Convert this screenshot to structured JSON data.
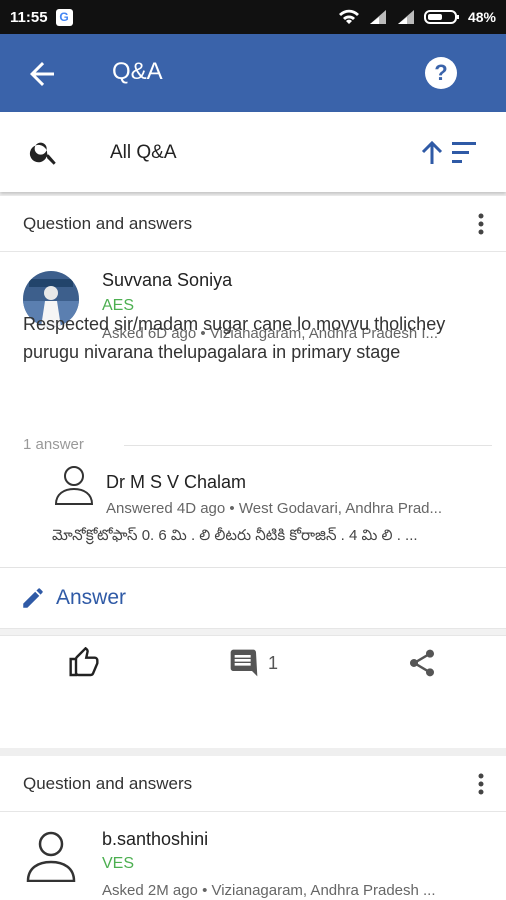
{
  "status_bar": {
    "time": "11:55",
    "app_badge": "G",
    "battery": "48%"
  },
  "app_bar": {
    "title": "Q&A",
    "back_icon": "arrow-left-icon",
    "help_label": "?"
  },
  "filter_bar": {
    "label": "All Q&A",
    "search_icon": "search-icon",
    "sort_icon": "sort-ascending-icon"
  },
  "posts": [
    {
      "section_title": "Question and answers",
      "user_name": "Suvvana Soniya",
      "role": "AES",
      "asked": "Asked 6D ago",
      "location": "Vizianagaram, Andhra Pradesh I...",
      "question": "Respected sir/madam sugar cane lo movvu tholichey purugu nivarana thelupagalara in primary stage",
      "answer_count": "1 answer",
      "answer": {
        "name": "Dr M S V Chalam",
        "answered": "Answered 4D ago",
        "location": "West Godavari, Andhra Prad...",
        "text": "మోనోక్రోటోఫాస్ 0. 6 మి . లి లీటరు నీటికి కోరాజిన్ . 4 మి లి . ..."
      },
      "answer_button": "Answer",
      "comment_count": "1"
    },
    {
      "section_title": "Question and answers",
      "user_name": "b.santhoshini",
      "role": "VES",
      "asked": "Asked 2M ago",
      "location": "Vizianagaram, Andhra Pradesh ..."
    }
  ],
  "colors": {
    "app_bar": "#3a63aa",
    "role": "#4caf50",
    "link": "#2f5aa6"
  }
}
